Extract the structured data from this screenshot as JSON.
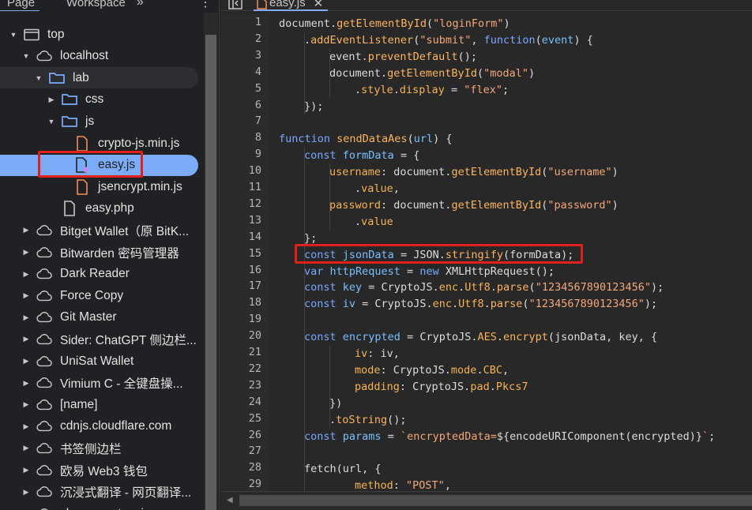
{
  "tabs": {
    "page": "Page",
    "workspace": "Workspace",
    "more": "»",
    "kebab": "⋮"
  },
  "tree": [
    {
      "label": "top",
      "type": "frame",
      "expanded": true,
      "indent": 0
    },
    {
      "label": "localhost",
      "type": "cloud",
      "expanded": true,
      "indent": 1
    },
    {
      "label": "lab",
      "type": "folder",
      "expanded": true,
      "indent": 2,
      "selected": "soft"
    },
    {
      "label": "css",
      "type": "folder",
      "expanded": false,
      "indent": 3
    },
    {
      "label": "js",
      "type": "folder",
      "expanded": true,
      "indent": 3
    },
    {
      "label": "crypto-js.min.js",
      "type": "jsfile",
      "indent": 4
    },
    {
      "label": "easy.js",
      "type": "jsfile-active",
      "indent": 4,
      "selected": "strong"
    },
    {
      "label": "jsencrypt.min.js",
      "type": "jsfile",
      "indent": 4
    },
    {
      "label": "easy.php",
      "type": "file",
      "indent": 3
    },
    {
      "label": "Bitget Wallet（原 BitK...",
      "type": "cloud",
      "expanded": false,
      "indent": 1
    },
    {
      "label": "Bitwarden 密码管理器",
      "type": "cloud",
      "expanded": false,
      "indent": 1
    },
    {
      "label": "Dark Reader",
      "type": "cloud",
      "expanded": false,
      "indent": 1
    },
    {
      "label": "Force Copy",
      "type": "cloud",
      "expanded": false,
      "indent": 1
    },
    {
      "label": "Git Master",
      "type": "cloud",
      "expanded": false,
      "indent": 1
    },
    {
      "label": "Sider: ChatGPT 侧边栏...",
      "type": "cloud",
      "expanded": false,
      "indent": 1
    },
    {
      "label": "UniSat Wallet",
      "type": "cloud",
      "expanded": false,
      "indent": 1
    },
    {
      "label": "Vimium C - 全键盘操...",
      "type": "cloud",
      "expanded": false,
      "indent": 1
    },
    {
      "label": "[name]",
      "type": "cloud",
      "expanded": false,
      "indent": 1
    },
    {
      "label": "cdnjs.cloudflare.com",
      "type": "cloud",
      "expanded": false,
      "indent": 1
    },
    {
      "label": "书签侧边栏",
      "type": "cloud",
      "expanded": false,
      "indent": 1
    },
    {
      "label": "欧易 Web3 钱包",
      "type": "cloud",
      "expanded": false,
      "indent": 1
    },
    {
      "label": "沉浸式翻译 - 网页翻译...",
      "type": "cloud",
      "expanded": false,
      "indent": 1
    },
    {
      "label": "chrome-extension",
      "type": "cloud",
      "expanded": false,
      "indent": 1
    }
  ],
  "editor": {
    "file_tab": "easy.js",
    "close_glyph": "✕",
    "lines": [
      {
        "n": "1",
        "indent": 0,
        "tokens": [
          [
            "p",
            "document."
          ],
          [
            "f",
            "getElementById"
          ],
          [
            "p",
            "("
          ],
          [
            "s",
            "\"loginForm\""
          ],
          [
            "p",
            ")"
          ]
        ]
      },
      {
        "n": "2",
        "indent": 1,
        "tokens": [
          [
            "p",
            "."
          ],
          [
            "f",
            "addEventListener"
          ],
          [
            "p",
            "("
          ],
          [
            "s",
            "\"submit\""
          ],
          [
            "p",
            ", "
          ],
          [
            "k",
            "function"
          ],
          [
            "p",
            "("
          ],
          [
            "v",
            "event"
          ],
          [
            "p",
            ") {"
          ]
        ]
      },
      {
        "n": "3",
        "indent": 2,
        "tokens": [
          [
            "p",
            "event."
          ],
          [
            "f",
            "preventDefault"
          ],
          [
            "p",
            "();"
          ]
        ]
      },
      {
        "n": "4",
        "indent": 2,
        "tokens": [
          [
            "p",
            "document."
          ],
          [
            "f",
            "getElementById"
          ],
          [
            "p",
            "("
          ],
          [
            "s",
            "\"modal\""
          ],
          [
            "p",
            ")"
          ]
        ]
      },
      {
        "n": "5",
        "indent": 3,
        "tokens": [
          [
            "p",
            "."
          ],
          [
            "prop",
            "style"
          ],
          [
            "p",
            "."
          ],
          [
            "prop",
            "display"
          ],
          [
            "p",
            " = "
          ],
          [
            "s",
            "\"flex\""
          ],
          [
            "p",
            ";"
          ]
        ]
      },
      {
        "n": "6",
        "indent": 1,
        "tokens": [
          [
            "p",
            "});"
          ]
        ]
      },
      {
        "n": "7",
        "indent": 0,
        "tokens": []
      },
      {
        "n": "8",
        "indent": 0,
        "tokens": [
          [
            "k",
            "function "
          ],
          [
            "f",
            "sendDataAes"
          ],
          [
            "p",
            "("
          ],
          [
            "v",
            "url"
          ],
          [
            "p",
            ") {"
          ]
        ]
      },
      {
        "n": "9",
        "indent": 1,
        "tokens": [
          [
            "k",
            "const "
          ],
          [
            "v",
            "formData"
          ],
          [
            "p",
            " = {"
          ]
        ]
      },
      {
        "n": "10",
        "indent": 2,
        "tokens": [
          [
            "prop",
            "username"
          ],
          [
            "p",
            ": document."
          ],
          [
            "f",
            "getElementById"
          ],
          [
            "p",
            "("
          ],
          [
            "s",
            "\"username\""
          ],
          [
            "p",
            ")"
          ]
        ]
      },
      {
        "n": "11",
        "indent": 3,
        "tokens": [
          [
            "p",
            "."
          ],
          [
            "prop",
            "value"
          ],
          [
            "p",
            ","
          ]
        ]
      },
      {
        "n": "12",
        "indent": 2,
        "tokens": [
          [
            "prop",
            "password"
          ],
          [
            "p",
            ": document."
          ],
          [
            "f",
            "getElementById"
          ],
          [
            "p",
            "("
          ],
          [
            "s",
            "\"password\""
          ],
          [
            "p",
            ")"
          ]
        ]
      },
      {
        "n": "13",
        "indent": 3,
        "tokens": [
          [
            "p",
            "."
          ],
          [
            "prop",
            "value"
          ]
        ]
      },
      {
        "n": "14",
        "indent": 1,
        "tokens": [
          [
            "p",
            "};"
          ]
        ]
      },
      {
        "n": "15",
        "indent": 1,
        "tokens": [
          [
            "k",
            "const "
          ],
          [
            "v",
            "jsonData"
          ],
          [
            "p",
            " = JSON."
          ],
          [
            "f",
            "stringify"
          ],
          [
            "p",
            "(formData);"
          ]
        ]
      },
      {
        "n": "16",
        "indent": 1,
        "tokens": [
          [
            "k",
            "var "
          ],
          [
            "v",
            "httpRequest"
          ],
          [
            "p",
            " = "
          ],
          [
            "k",
            "new "
          ],
          [
            "p",
            "XMLHttpRequest();"
          ]
        ]
      },
      {
        "n": "17",
        "indent": 1,
        "tokens": [
          [
            "k",
            "const "
          ],
          [
            "v",
            "key"
          ],
          [
            "p",
            " = CryptoJS."
          ],
          [
            "prop",
            "enc"
          ],
          [
            "p",
            "."
          ],
          [
            "prop",
            "Utf8"
          ],
          [
            "p",
            "."
          ],
          [
            "f",
            "parse"
          ],
          [
            "p",
            "("
          ],
          [
            "s",
            "\"1234567890123456\""
          ],
          [
            "p",
            ");"
          ]
        ]
      },
      {
        "n": "18",
        "indent": 1,
        "tokens": [
          [
            "k",
            "const "
          ],
          [
            "v",
            "iv"
          ],
          [
            "p",
            " = CryptoJS."
          ],
          [
            "prop",
            "enc"
          ],
          [
            "p",
            "."
          ],
          [
            "prop",
            "Utf8"
          ],
          [
            "p",
            "."
          ],
          [
            "f",
            "parse"
          ],
          [
            "p",
            "("
          ],
          [
            "s",
            "\"1234567890123456\""
          ],
          [
            "p",
            ");"
          ]
        ]
      },
      {
        "n": "19",
        "indent": 0,
        "tokens": []
      },
      {
        "n": "20",
        "indent": 1,
        "tokens": [
          [
            "k",
            "const "
          ],
          [
            "v",
            "encrypted"
          ],
          [
            "p",
            " = CryptoJS."
          ],
          [
            "prop",
            "AES"
          ],
          [
            "p",
            "."
          ],
          [
            "f",
            "encrypt"
          ],
          [
            "p",
            "(jsonData, key, {"
          ]
        ]
      },
      {
        "n": "21",
        "indent": 3,
        "tokens": [
          [
            "prop",
            "iv"
          ],
          [
            "p",
            ": iv,"
          ]
        ]
      },
      {
        "n": "22",
        "indent": 3,
        "tokens": [
          [
            "prop",
            "mode"
          ],
          [
            "p",
            ": CryptoJS."
          ],
          [
            "prop",
            "mode"
          ],
          [
            "p",
            "."
          ],
          [
            "prop",
            "CBC"
          ],
          [
            "p",
            ","
          ]
        ]
      },
      {
        "n": "23",
        "indent": 3,
        "tokens": [
          [
            "prop",
            "padding"
          ],
          [
            "p",
            ": CryptoJS."
          ],
          [
            "prop",
            "pad"
          ],
          [
            "p",
            "."
          ],
          [
            "prop",
            "Pkcs7"
          ]
        ]
      },
      {
        "n": "24",
        "indent": 2,
        "tokens": [
          [
            "p",
            "})"
          ]
        ]
      },
      {
        "n": "25",
        "indent": 2,
        "tokens": [
          [
            "p",
            "."
          ],
          [
            "f",
            "toString"
          ],
          [
            "p",
            "();"
          ]
        ]
      },
      {
        "n": "26",
        "indent": 1,
        "tokens": [
          [
            "k",
            "const "
          ],
          [
            "v",
            "params"
          ],
          [
            "p",
            " = "
          ],
          [
            "s",
            "`encryptedData="
          ],
          [
            "p",
            "${encodeURIComponent(encrypted)}"
          ],
          [
            "s",
            "`"
          ],
          [
            "p",
            ";"
          ]
        ]
      },
      {
        "n": "27",
        "indent": 0,
        "tokens": []
      },
      {
        "n": "28",
        "indent": 1,
        "tokens": [
          [
            "p",
            "fetch(url, {"
          ]
        ]
      },
      {
        "n": "29",
        "indent": 3,
        "tokens": [
          [
            "prop",
            "method"
          ],
          [
            "p",
            ": "
          ],
          [
            "s",
            "\"POST\""
          ],
          [
            "p",
            ","
          ]
        ]
      }
    ]
  },
  "colors": {
    "accent": "#7cacf8",
    "highlight_box": "#e0201b",
    "selected_row": "#7cacf8"
  },
  "icons": {
    "folder": "folder-icon",
    "cloud": "cloud-icon",
    "frame": "frame-icon",
    "file": "file-icon",
    "jsfile": "js-file-icon"
  }
}
